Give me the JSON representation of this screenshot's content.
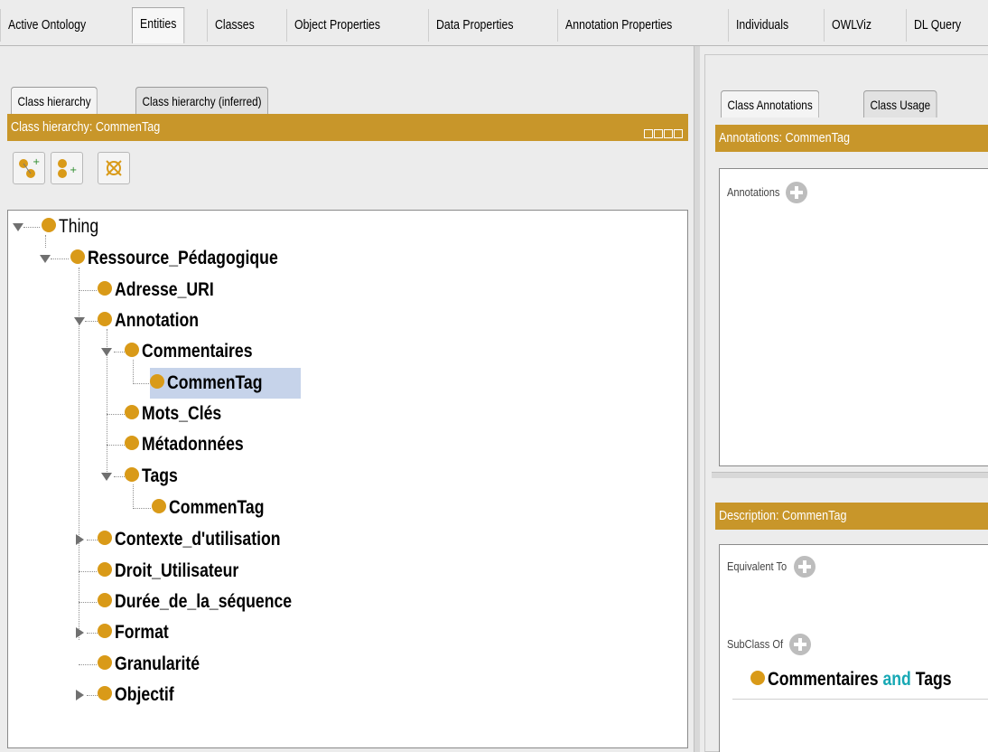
{
  "top_tabs": [
    {
      "label": "Active Ontology"
    },
    {
      "label": "Entities"
    },
    {
      "label": "Classes"
    },
    {
      "label": "Object Properties"
    },
    {
      "label": "Data Properties"
    },
    {
      "label": "Annotation Properties"
    },
    {
      "label": "Individuals"
    },
    {
      "label": "OWLViz"
    },
    {
      "label": "DL Query"
    }
  ],
  "active_top_tab": "Entities",
  "left": {
    "tabs": [
      {
        "label": "Class hierarchy"
      },
      {
        "label": "Class hierarchy (inferred)"
      }
    ],
    "header": "Class hierarchy: CommenTag",
    "tree": [
      {
        "label": "Thing"
      },
      {
        "label": "Ressource_Pédagogique"
      },
      {
        "label": "Adresse_URI"
      },
      {
        "label": "Annotation"
      },
      {
        "label": "Commentaires"
      },
      {
        "label": "CommenTag"
      },
      {
        "label": "Mots_Clés"
      },
      {
        "label": "Métadonnées"
      },
      {
        "label": "Tags"
      },
      {
        "label": "CommenTag"
      },
      {
        "label": "Contexte_d'utilisation"
      },
      {
        "label": "Droit_Utilisateur"
      },
      {
        "label": "Durée_de_la_séquence"
      },
      {
        "label": "Format"
      },
      {
        "label": "Granularité"
      },
      {
        "label": "Objectif"
      }
    ]
  },
  "right": {
    "tabs": [
      {
        "label": "Class Annotations"
      },
      {
        "label": "Class Usage"
      }
    ],
    "annotations_header": "Annotations: CommenTag",
    "annotations_label": "Annotations",
    "description_header": "Description: CommenTag",
    "equivalent_label": "Equivalent To",
    "subclass_label": "SubClass Of",
    "subclass_expr": {
      "left": "Commentaires",
      "op": "and",
      "right": "Tags"
    }
  },
  "colors": {
    "accent": "#c8962a",
    "class_bullet": "#d99a18",
    "keyword": "#16a8b4",
    "selection": "#c6d3ea"
  }
}
